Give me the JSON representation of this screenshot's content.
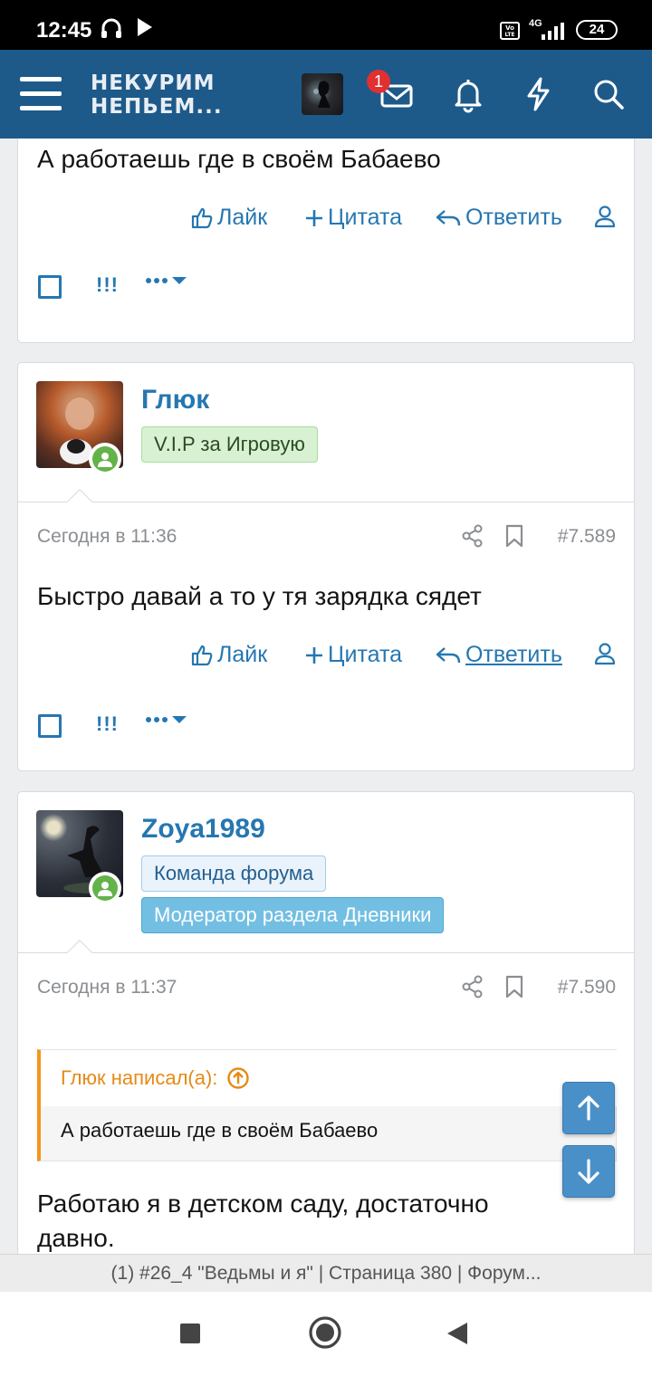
{
  "status_bar": {
    "time": "12:45",
    "network": "4G",
    "battery": "24"
  },
  "header": {
    "logo_line1": "НЕКУРИМ",
    "logo_line2": "НЕПЬЕМ...",
    "inbox_badge": "1"
  },
  "actions": {
    "like": "Лайк",
    "quote": "Цитата",
    "reply": "Ответить",
    "multi_select": "!!!"
  },
  "posts": [
    {
      "text": "А работаешь где в своём Бабаево"
    },
    {
      "username": "Глюк",
      "tags": [
        "V.I.P за Игровую"
      ],
      "date": "Сегодня в 11:36",
      "number": "#7.589",
      "text": "Быстро давай а то у тя зарядка сядет"
    },
    {
      "username": "Zoya1989",
      "tags": [
        "Команда форума",
        "Модератор раздела Дневники"
      ],
      "date": "Сегодня в 11:37",
      "number": "#7.590",
      "quote_author": "Глюк написал(а):",
      "quote_text": "А работаешь где в своём Бабаево",
      "text_line1": "Работаю я в детском саду, достаточно",
      "text_line2": "давно."
    }
  ],
  "url_bar": {
    "title": "(1) #26_4 \"Ведьмы и я\" | Страница 380 | Форум..."
  },
  "colors": {
    "header": "#1d5a8a",
    "link": "#2577b1",
    "quote_accent": "#f3961d",
    "online": "#63b34a"
  }
}
